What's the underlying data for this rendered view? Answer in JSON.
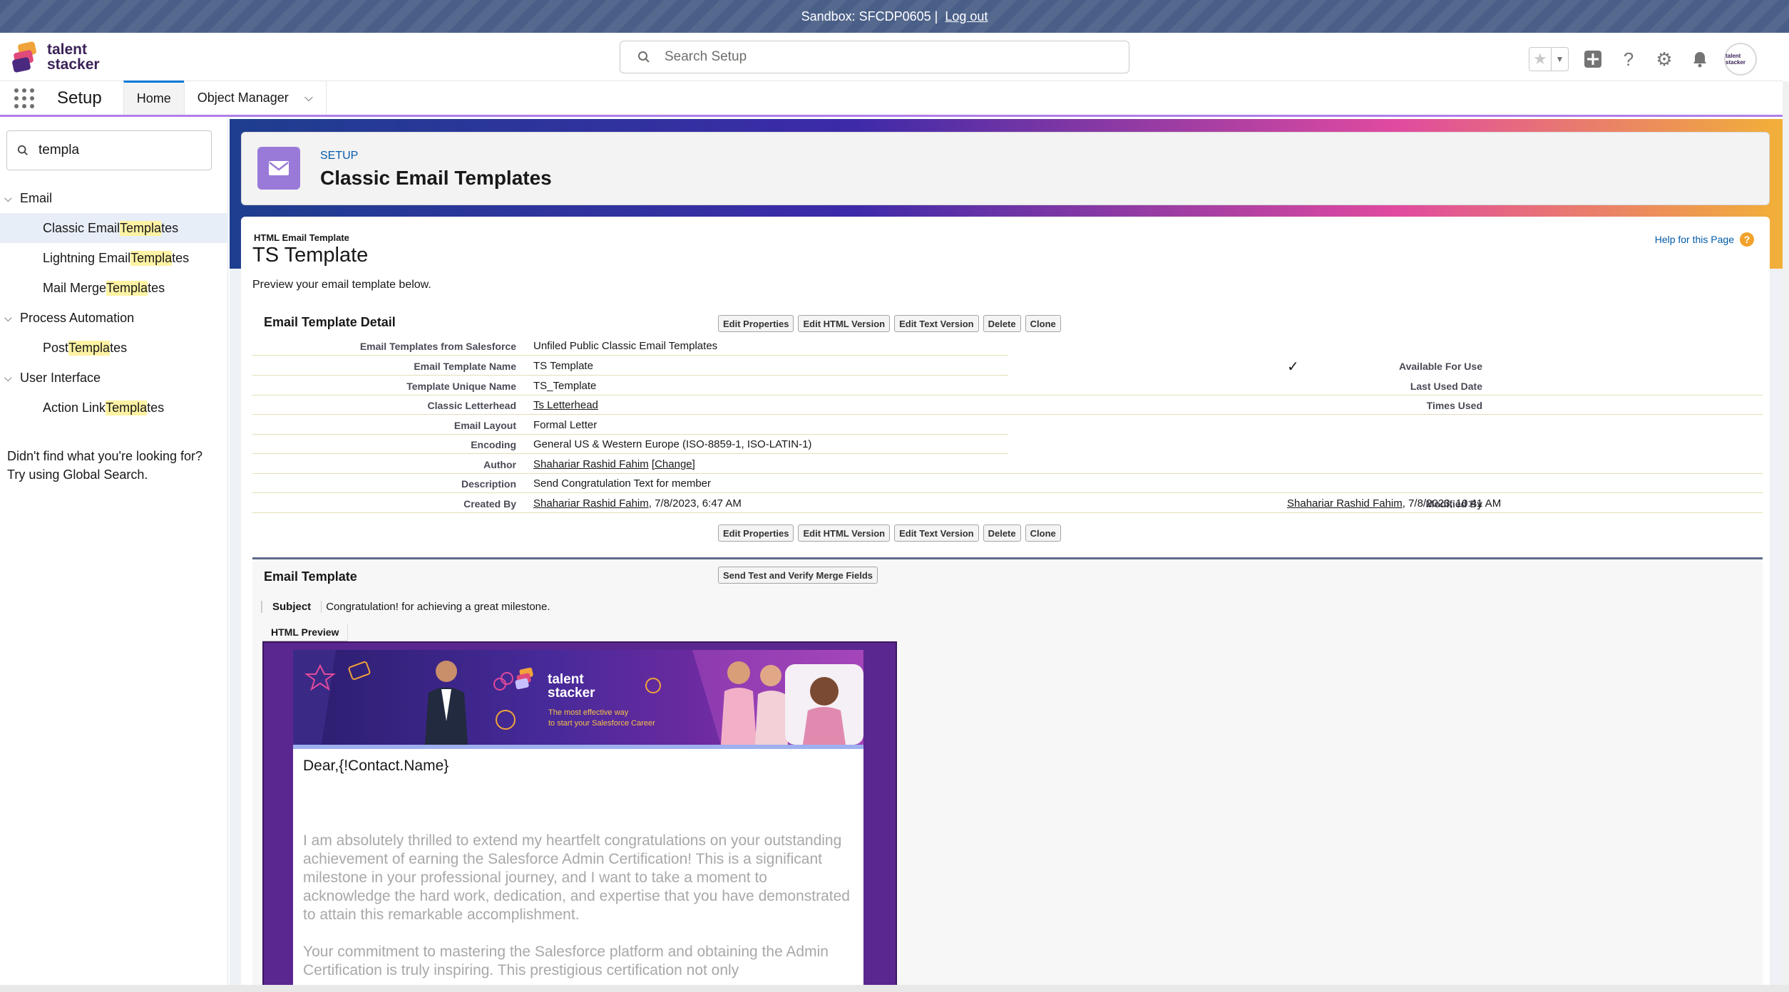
{
  "sandbox": {
    "label": "Sandbox: SFCDP0605 |",
    "logout": "Log out"
  },
  "logo": {
    "line1": "talent",
    "line2": "stacker"
  },
  "header": {
    "search_placeholder": "Search Setup",
    "avatar_text": "talent stacker"
  },
  "nav": {
    "app_name": "Setup",
    "tabs": [
      {
        "label": "Home"
      },
      {
        "label": "Object Manager"
      }
    ]
  },
  "sidebar": {
    "quick_find_value": "templa",
    "groups": [
      {
        "label": "Email",
        "items": [
          {
            "pre": "Classic Email ",
            "hl": "Templa",
            "post": "tes"
          },
          {
            "pre": "Lightning Email ",
            "hl": "Templa",
            "post": "tes"
          },
          {
            "pre": "Mail Merge ",
            "hl": "Templa",
            "post": "tes"
          }
        ]
      },
      {
        "label": "Process Automation",
        "items": [
          {
            "pre": "Post ",
            "hl": "Templa",
            "post": "tes"
          }
        ]
      },
      {
        "label": "User Interface",
        "items": [
          {
            "pre": "Action Link ",
            "hl": "Templa",
            "post": "tes"
          }
        ]
      }
    ],
    "no_result_line1": "Didn't find what you're looking for?",
    "no_result_line2": "Try using Global Search."
  },
  "page_header": {
    "eyebrow": "SETUP",
    "title": "Classic Email Templates"
  },
  "template": {
    "type": "HTML Email Template",
    "name": "TS Template",
    "description": "Preview your email template below.",
    "help": "Help for this Page"
  },
  "detail": {
    "title": "Email Template Detail",
    "buttons": [
      "Edit Properties",
      "Edit HTML Version",
      "Edit Text Version",
      "Delete",
      "Clone"
    ],
    "fields": {
      "folder_label": "Email Templates from Salesforce",
      "folder_value": "Unfiled Public Classic Email Templates",
      "name_label": "Email Template Name",
      "name_value": "TS Template",
      "available_label": "Available For Use",
      "available_value": "✓",
      "unique_label": "Template Unique Name",
      "unique_value": "TS_Template",
      "lastused_label": "Last Used Date",
      "letterhead_label": "Classic Letterhead",
      "letterhead_value": "Ts Letterhead",
      "timesused_label": "Times Used",
      "layout_label": "Email Layout",
      "layout_value": "Formal Letter",
      "encoding_label": "Encoding",
      "encoding_value": "General US & Western Europe (ISO-8859-1, ISO-LATIN-1)",
      "author_label": "Author",
      "author_value": "Shahariar Rashid Fahim",
      "author_change": "[Change]",
      "desc_label": "Description",
      "desc_value": "Send Congratulation Text for member",
      "created_label": "Created By",
      "created_user": "Shahariar Rashid Fahim",
      "created_date": ", 7/8/2023, 6:47 AM",
      "modified_label": "Modified By",
      "modified_user": "Shahariar Rashid Fahim",
      "modified_date": ", 7/8/2023, 10:41 AM"
    }
  },
  "email_template": {
    "title": "Email Template",
    "send_test": "Send Test and Verify Merge Fields",
    "subject_label": "Subject",
    "subject_value": "Congratulation! for achieving a great milestone.",
    "preview_tab": "HTML Preview",
    "banner_brand1": "talent",
    "banner_brand2": "stacker",
    "banner_tag1": "The most effective way",
    "banner_tag2": "to start your Salesforce Career",
    "greeting": "Dear,{!Contact.Name}",
    "para1": "I am absolutely thrilled to extend my heartfelt congratulations on your outstanding achievement of earning the Salesforce Admin Certification! This is a significant milestone in your professional journey, and I want to take a moment to acknowledge the hard work, dedication, and expertise that you have demonstrated to attain this remarkable accomplishment.",
    "para2": "Your commitment to mastering the Salesforce platform and obtaining the Admin Certification is truly inspiring. This prestigious certification not only"
  },
  "colors": {
    "brand_purple": "#5a2790",
    "accent_blue": "#0176d3",
    "nav_underline": "#b07ee8"
  }
}
